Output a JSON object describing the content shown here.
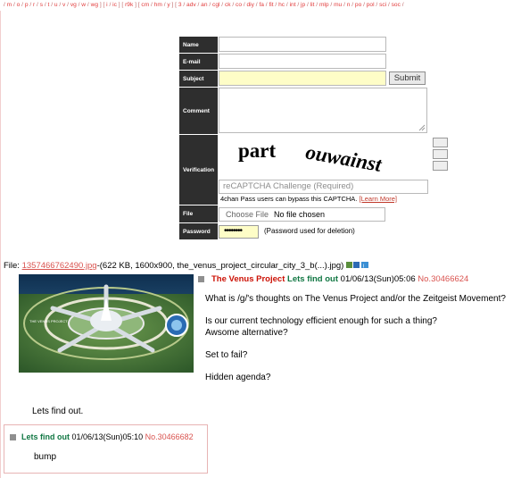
{
  "board_nav": {
    "items": [
      "/",
      "m",
      "/",
      "o",
      "/",
      "p",
      "/",
      "r",
      "/",
      "s",
      "/",
      "t",
      "/",
      "u",
      "/",
      "v",
      "/",
      "vg",
      "/",
      "w",
      "/",
      "wg",
      "] [",
      "i",
      "/",
      "ic",
      "] [",
      "r9k",
      "] [",
      "cm",
      "/",
      "hm",
      "/",
      "y",
      "] [",
      "3",
      "/",
      "adv",
      "/",
      "an",
      "/",
      "cgl",
      "/",
      "ck",
      "/",
      "co",
      "/",
      "diy",
      "/",
      "fa",
      "/",
      "fit",
      "/",
      "hc",
      "/",
      "int",
      "/",
      "jp",
      "/",
      "lit",
      "/",
      "mlp",
      "/",
      "mu",
      "/",
      "n",
      "/",
      "po",
      "/",
      "pol",
      "/",
      "sci",
      "/",
      "soc",
      "/"
    ]
  },
  "form": {
    "labels": {
      "name": "Name",
      "email": "E-mail",
      "subject": "Subject",
      "comment": "Comment",
      "verification": "Verification",
      "file": "File",
      "password": "Password"
    },
    "submit_label": "Submit",
    "captcha_words": [
      "part",
      "ouwainst"
    ],
    "captcha_placeholder": "reCAPTCHA Challenge (Required)",
    "pass_note": "4chan Pass users can bypass this CAPTCHA.",
    "pass_note_link": "[Learn More]",
    "choose_file": "Choose File",
    "no_file": "No file chosen",
    "password_value": "••••••••",
    "password_note": "(Password used for deletion)"
  },
  "op": {
    "file_prefix": "File: ",
    "file_name": "1357466762490.jpg",
    "file_meta": "-(622 KB, 1600x900, the_venus_project_circular_city_3_b(...).jpg)",
    "subject": "The Venus Project",
    "name": "Lets find out",
    "datetime": "01/06/13(Sun)05:06",
    "post_no": "No.30466624",
    "body": [
      "What is /g/'s thoughts on The Venus Project and/or the Zeitgeist Movement?",
      "",
      "Is our current technology efficient enough for such a thing?",
      "Awsome alternative?",
      "",
      "Set to fail?",
      "",
      "Hidden agenda?"
    ]
  },
  "bottom_text": "Lets find out.",
  "reply": {
    "name": "Lets find out",
    "datetime": "01/06/13(Sun)05:10",
    "post_no": "No.30466682",
    "body": "bump"
  },
  "colors": {
    "label_bg": "#2e2e2e",
    "link": "#d9534f",
    "name": "#117743",
    "subject": "#cc1105",
    "input_yellow": "#fefdc7"
  }
}
